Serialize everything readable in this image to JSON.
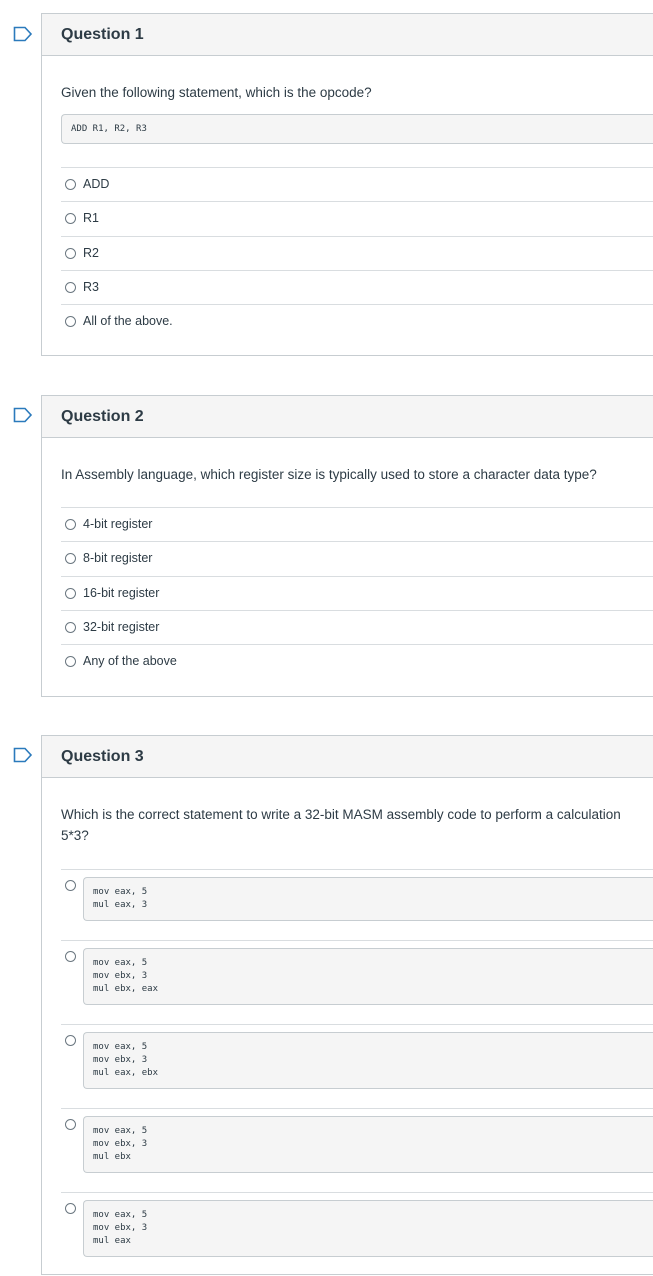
{
  "questions": [
    {
      "title": "Question 1",
      "text": "Given the following statement, which is the opcode?",
      "code": "ADD R1, R2, R3",
      "answers": [
        "ADD",
        "R1",
        "R2",
        "R3",
        "All of the above."
      ]
    },
    {
      "title": "Question 2",
      "text": "In Assembly language, which register size is typically used to store a character data type?",
      "answers": [
        "4-bit register",
        "8-bit register",
        "16-bit register",
        "32-bit register",
        "Any of the above"
      ]
    },
    {
      "title": "Question 3",
      "text_line1": "Which is the correct statement to write a 32-bit MASM assembly code to perform a calculation",
      "text_line2": "5*3?",
      "answers": [
        [
          "mov eax, 5",
          "mul eax, 3"
        ],
        [
          "mov eax, 5",
          "mov ebx, 3",
          "mul ebx, eax"
        ],
        [
          "mov eax, 5",
          "mov ebx, 3",
          "mul eax, ebx"
        ],
        [
          "mov eax, 5",
          "mov ebx, 3",
          "mul ebx"
        ],
        [
          "mov eax, 5",
          "mov ebx, 3",
          "mul eax"
        ]
      ]
    }
  ],
  "icons": {
    "flag": "flag-outline-icon",
    "radio": "radio-button-icon"
  },
  "colors": {
    "flag_stroke": "#2b7abc",
    "header_bg": "#f5f5f5",
    "border": "#c7cdd1",
    "text": "#2d3b45"
  }
}
